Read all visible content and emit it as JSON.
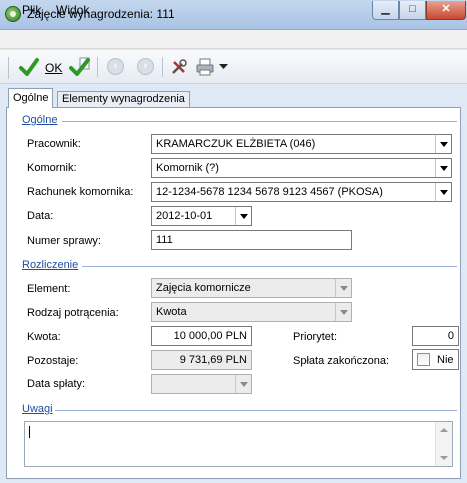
{
  "window": {
    "title": "Zajęcie wynagrodzenia: 111"
  },
  "menu": [
    "Plik",
    "Widok"
  ],
  "toolbar": {
    "ok_label": "OK"
  },
  "tabs": [
    "Ogólne",
    "Elementy wynagrodzenia"
  ],
  "sections": {
    "general": "Ogólne",
    "settlement": "Rozliczenie",
    "notes": "Uwagi"
  },
  "form": {
    "pracownik": {
      "label": "Pracownik:",
      "value": "KRAMARCZUK ELŻBIETA (046)"
    },
    "komornik": {
      "label": "Komornik:",
      "value": "Komornik (?)"
    },
    "rachunek": {
      "label": "Rachunek komornika:",
      "value": "12-1234-5678 1234 5678 9123 4567 (PKOSA)"
    },
    "data": {
      "label": "Data:",
      "value": "2012-10-01"
    },
    "numer": {
      "label": "Numer sprawy:",
      "value": "111"
    },
    "element": {
      "label": "Element:",
      "value": "Zajęcia komornicze"
    },
    "rodzaj": {
      "label": "Rodzaj potrącenia:",
      "value": "Kwota"
    },
    "kwota": {
      "label": "Kwota:",
      "value": "10 000,00 PLN"
    },
    "pozostaje": {
      "label": "Pozostaje:",
      "value": "9 731,69 PLN"
    },
    "data_splaty": {
      "label": "Data spłaty:",
      "value": ""
    },
    "priorytet": {
      "label": "Priorytet:",
      "value": "0"
    },
    "splata": {
      "label": "Spłata zakończona:",
      "value": "Nie",
      "checked": false
    },
    "uwagi": {
      "value": ""
    }
  },
  "icons": {
    "app": "app-icon",
    "ok": "green-check-icon",
    "ok_new": "green-check-new-icon",
    "back": "back-arrow-icon",
    "forward": "forward-arrow-icon",
    "tools": "tools-icon",
    "print": "printer-icon"
  },
  "colors": {
    "section_heading": "#1f4da0",
    "titlebar": "#b6cce8",
    "close_button": "#c8492f"
  }
}
